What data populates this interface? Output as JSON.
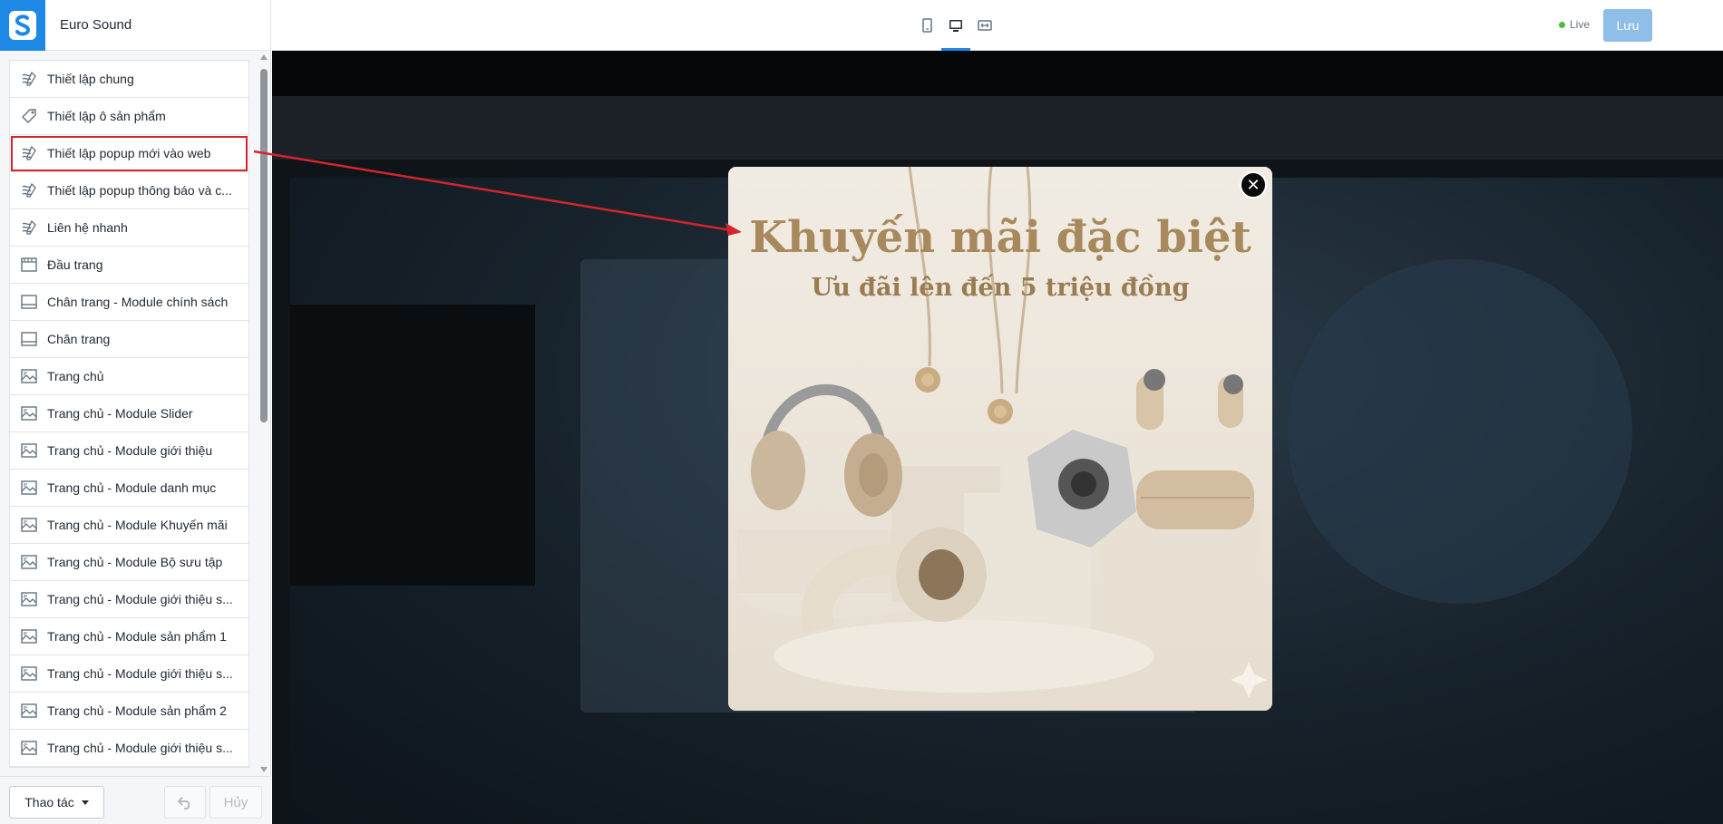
{
  "app": {
    "store_name": "Euro Sound"
  },
  "sidebar": {
    "items": [
      {
        "label": "Thiết lập chung",
        "icon": "settings-brush-icon",
        "highlight": false
      },
      {
        "label": "Thiết lập ô sản phẩm",
        "icon": "tag-icon",
        "highlight": false
      },
      {
        "label": "Thiết lập popup mới vào web",
        "icon": "settings-brush-icon",
        "highlight": true
      },
      {
        "label": "Thiết lập popup thông báo và c...",
        "icon": "settings-brush-icon",
        "highlight": false
      },
      {
        "label": "Liên hệ nhanh",
        "icon": "settings-brush-icon",
        "highlight": false
      },
      {
        "label": "Đầu trang",
        "icon": "header-layout-icon",
        "highlight": false
      },
      {
        "label": "Chân trang - Module chính sách",
        "icon": "footer-layout-icon",
        "highlight": false
      },
      {
        "label": "Chân trang",
        "icon": "footer-layout-icon",
        "highlight": false
      },
      {
        "label": "Trang chủ",
        "icon": "image-section-icon",
        "highlight": false
      },
      {
        "label": "Trang chủ - Module Slider",
        "icon": "image-section-icon",
        "highlight": false
      },
      {
        "label": "Trang chủ - Module giới thiệu",
        "icon": "image-section-icon",
        "highlight": false
      },
      {
        "label": "Trang chủ - Module danh mục",
        "icon": "image-section-icon",
        "highlight": false
      },
      {
        "label": "Trang chủ - Module Khuyến mãi",
        "icon": "image-section-icon",
        "highlight": false
      },
      {
        "label": "Trang chủ - Module Bộ sưu tập",
        "icon": "image-section-icon",
        "highlight": false
      },
      {
        "label": "Trang chủ - Module giới thiệu s...",
        "icon": "image-section-icon",
        "highlight": false
      },
      {
        "label": "Trang chủ - Module sản phẩm 1",
        "icon": "image-section-icon",
        "highlight": false
      },
      {
        "label": "Trang chủ - Module giới thiệu s...",
        "icon": "image-section-icon",
        "highlight": false
      },
      {
        "label": "Trang chủ - Module sản phẩm 2",
        "icon": "image-section-icon",
        "highlight": false
      },
      {
        "label": "Trang chủ - Module giới thiệu s...",
        "icon": "image-section-icon",
        "highlight": false
      }
    ],
    "footer": {
      "action_label": "Thao tác",
      "cancel_label": "Hủy"
    }
  },
  "topbar": {
    "devices": [
      {
        "name": "mobile-view-icon",
        "active": false
      },
      {
        "name": "desktop-view-icon",
        "active": true
      },
      {
        "name": "fullwidth-view-icon",
        "active": false
      }
    ],
    "status": "Live",
    "save_label": "Lưu"
  },
  "popup": {
    "title": "Khuyến mãi đặc biệt",
    "subtitle": "Ưu đãi lên đến 5 triệu đồng"
  },
  "colors": {
    "brand": "#1e88e5",
    "highlight": "#d6242b",
    "live": "#50b83c",
    "save_button": "#8fbfe8",
    "promo_text": "#a8895d"
  }
}
